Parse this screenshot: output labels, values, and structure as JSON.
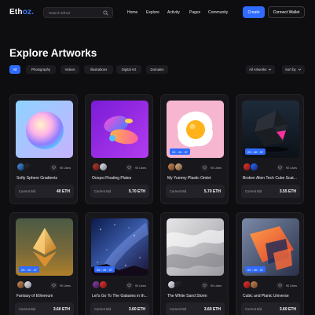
{
  "brand": {
    "logo_main": "Eth",
    "logo_accent": "oz."
  },
  "search": {
    "placeholder": "Search Ethoz"
  },
  "nav": {
    "items": [
      "Home",
      "Explore",
      "Activity",
      "Pages",
      "Community"
    ]
  },
  "header": {
    "create_label": "Create",
    "connect_label": "Connect Wallet"
  },
  "page": {
    "title": "Explore Artworks"
  },
  "filters": {
    "chips": [
      "All",
      "Photography",
      "Videos",
      "Illustrations",
      "Digital Art",
      "Domains"
    ],
    "active_index": 0,
    "sort_dropdowns": [
      "All Artworks",
      "Sort by"
    ]
  },
  "colors": {
    "accent": "#2f6bff",
    "background": "#0e0e10",
    "card": "#18181c"
  },
  "cards": [
    {
      "title": "Softy Sphere Gradients",
      "likes": "90 Likes",
      "bid_label": "Current Bid",
      "bid": "40 ETH",
      "timer": ""
    },
    {
      "title": "Ooopsi Floating Plates",
      "likes": "90 Likes",
      "bid_label": "Current Bid",
      "bid": "5.70 ETH",
      "timer": ""
    },
    {
      "title": "My Yummy Plastic Omlet",
      "likes": "90 Likes",
      "bid_label": "Current Bid",
      "bid": "5.70 ETH",
      "timer": "05 : 40 : 37"
    },
    {
      "title": "Broken Alien Tech Cube Scat...",
      "likes": "90 Likes",
      "bid_label": "Current Bid",
      "bid": "3.55 ETH",
      "timer": "05 : 40 : 37"
    },
    {
      "title": "Fantasy of Ethereum",
      "likes": "90 Likes",
      "bid_label": "Current Bid",
      "bid": "3.60 ETH",
      "timer": "05 : 40 : 37"
    },
    {
      "title": "Let's Go To The Galaxies in th...",
      "likes": "90 Likes",
      "bid_label": "Current Bid",
      "bid": "3.60 ETH",
      "timer": "05 : 40 : 37"
    },
    {
      "title": "The White Sand Storm",
      "likes": "90 Likes",
      "bid_label": "Current Bid",
      "bid": "3.60 ETH",
      "timer": ""
    },
    {
      "title": "Cubic and Planic Universe",
      "likes": "90 Likes",
      "bid_label": "Current Bid",
      "bid": "3.60 ETH",
      "timer": "05 : 40 : 37"
    }
  ]
}
